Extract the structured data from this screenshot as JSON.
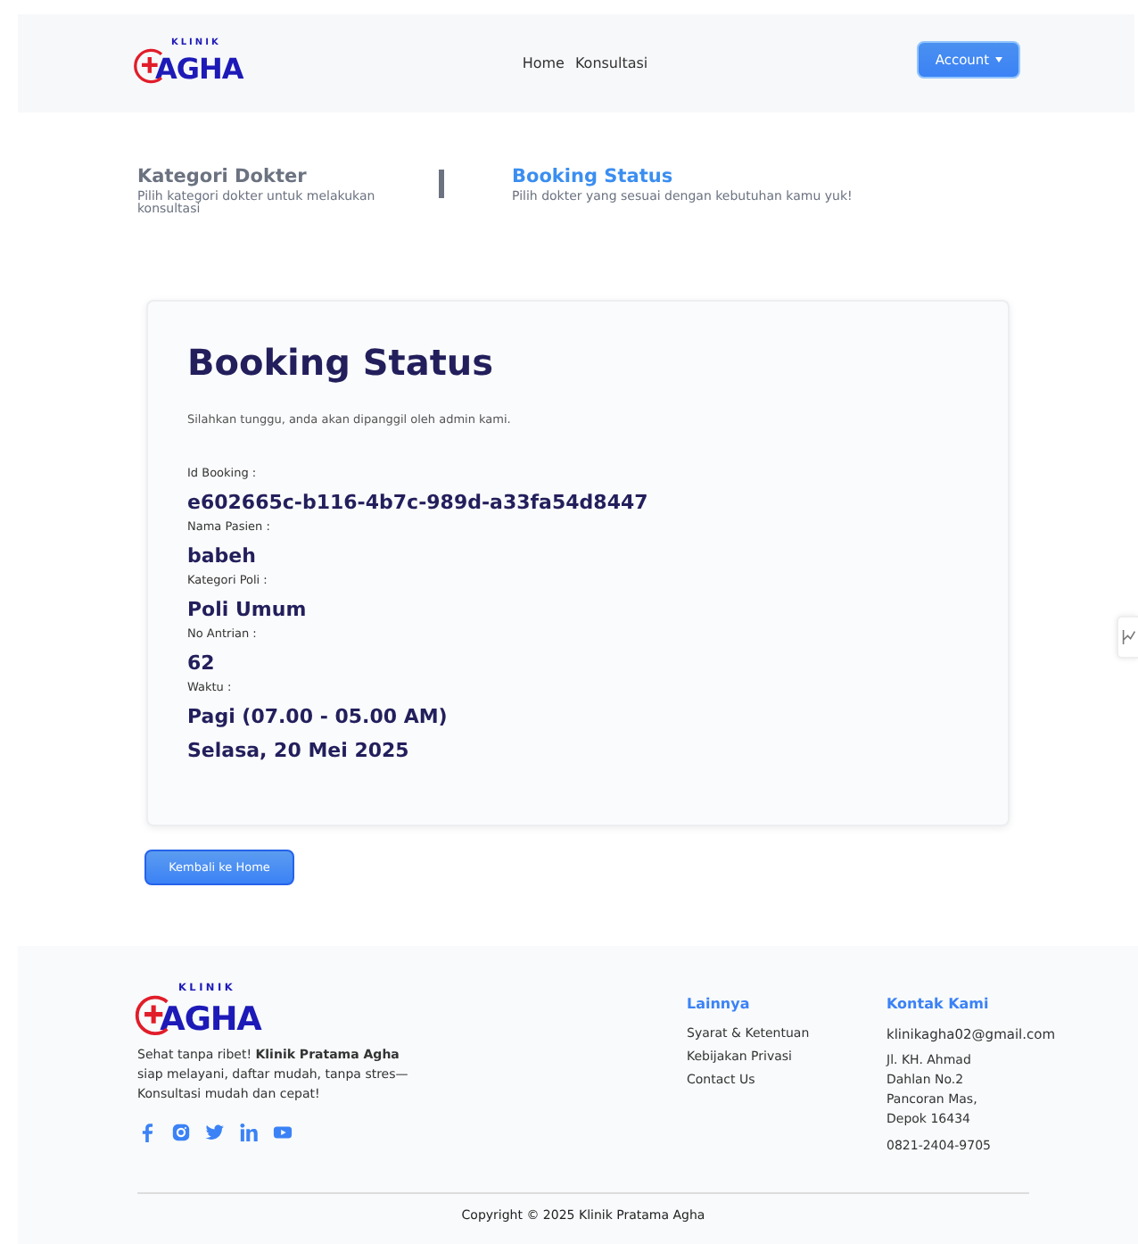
{
  "navbar": {
    "logo": {
      "top": "KLINIK",
      "main": "AGHA"
    },
    "links": [
      {
        "label": "Home"
      },
      {
        "label": "Konsultasi"
      }
    ],
    "account_button": "Account"
  },
  "steps": [
    {
      "title": "Kategori Dokter",
      "subtitle": "Pilih kategori dokter untuk melakukan konsultasi",
      "selected": false
    },
    {
      "title": "Booking Status",
      "subtitle": "Pilih dokter yang sesuai dengan kebutuhan kamu yuk!",
      "selected": true
    }
  ],
  "card": {
    "title": "Booking Status",
    "message": "Silahkan tunggu, anda akan dipanggil oleh admin kami.",
    "fields": [
      {
        "label": "Id Booking :",
        "values": [
          "e602665c-b116-4b7c-989d-a33fa54d8447"
        ]
      },
      {
        "label": "Nama Pasien :",
        "values": [
          "babeh"
        ]
      },
      {
        "label": "Kategori Poli :",
        "values": [
          "Poli Umum"
        ]
      },
      {
        "label": "No Antrian :",
        "values": [
          "62"
        ]
      },
      {
        "label": "Waktu :",
        "values": [
          "Pagi (07.00 - 05.00 AM)",
          "Selasa, 20 Mei 2025"
        ]
      }
    ]
  },
  "back_button": "Kembali ke Home",
  "footer": {
    "logo": {
      "top": "KLINIK",
      "main": "AGHA"
    },
    "description": "Sehat tanpa ribet! **Klinik Pratama Agha** siap melayani, daftar mudah, tanpa stres—Konsultasi mudah dan cepat!",
    "socials": [
      {
        "kind": "facebook"
      },
      {
        "kind": "instagram"
      },
      {
        "kind": "twitter"
      },
      {
        "kind": "linkedin"
      },
      {
        "kind": "youtube"
      }
    ],
    "columns": [
      {
        "title": "Lainnya",
        "items": [
          "Syarat & Ketentuan",
          "Kebijakan Privasi",
          "Contact Us"
        ],
        "kind": "links"
      },
      {
        "title": "Kontak Kami",
        "items": [
          "klinikagha02@gmail.com",
          "Jl. KH. Ahmad Dahlan No.2 Pancoran Mas, Depok 16434",
          "0821-2404-9705"
        ],
        "kind": "contact"
      }
    ],
    "copyright": "Copyright © 2025 Klinik Pratama Agha"
  }
}
